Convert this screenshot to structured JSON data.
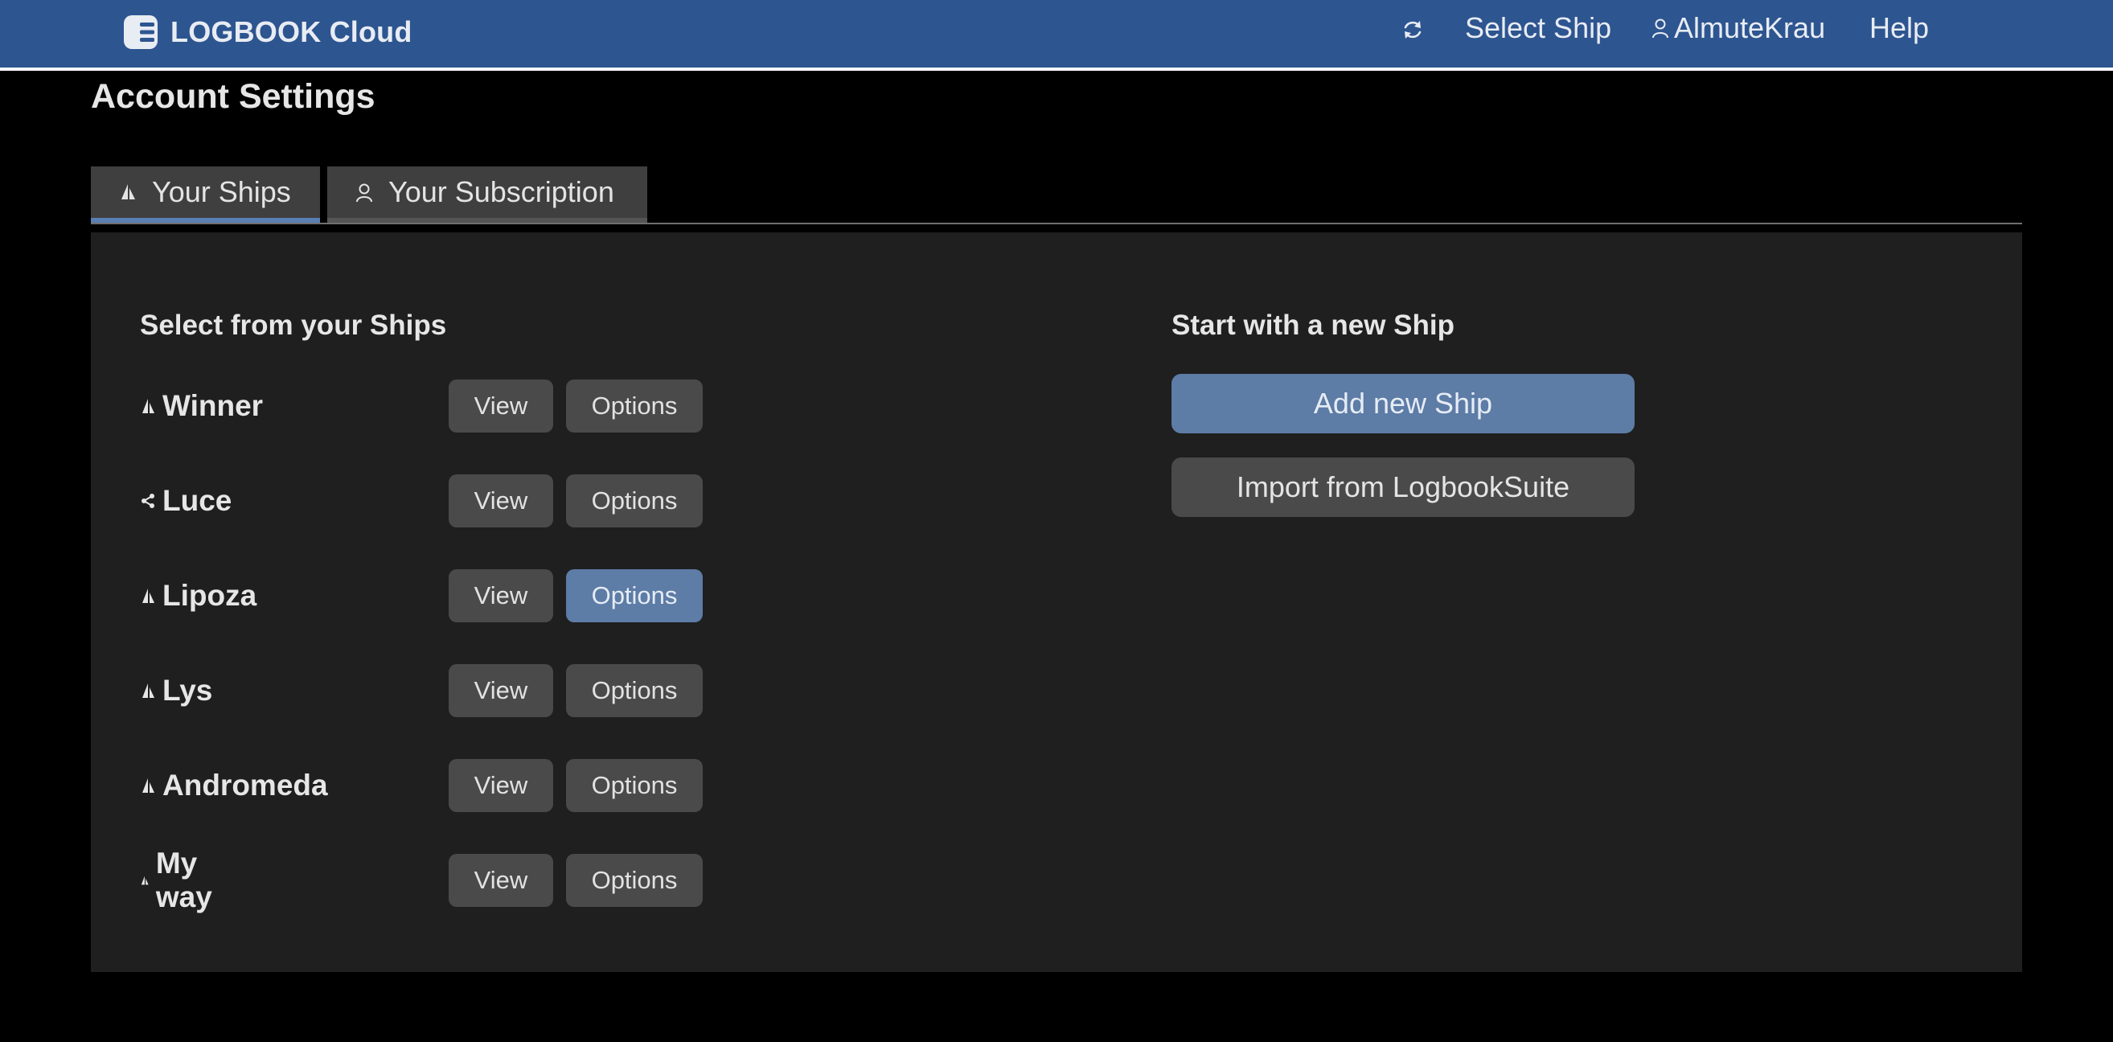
{
  "brand": {
    "name": "LOGBOOK Cloud"
  },
  "nav": {
    "select_ship": "Select Ship",
    "user": "AlmuteKrau",
    "help": "Help"
  },
  "page": {
    "title": "Account Settings"
  },
  "tabs": [
    {
      "label": "Your Ships",
      "active": true,
      "icon": "sailboat-icon"
    },
    {
      "label": "Your Subscription",
      "active": false,
      "icon": "user-icon"
    }
  ],
  "ships_section": {
    "title": "Select from your Ships",
    "view_label": "View",
    "options_label": "Options",
    "ships": [
      {
        "name": "Winner",
        "icon": "sailboat-icon"
      },
      {
        "name": "Luce",
        "icon": "share-icon"
      },
      {
        "name": "Lipoza",
        "icon": "sailboat-icon",
        "options_highlighted": true
      },
      {
        "name": "Lys",
        "icon": "sailboat-icon"
      },
      {
        "name": "Andromeda",
        "icon": "sailboat-icon"
      },
      {
        "name": "My way",
        "icon": "sailboat-icon"
      }
    ]
  },
  "new_ship_section": {
    "title": "Start with a new Ship",
    "add_button": "Add new Ship",
    "import_button": "Import from LogbookSuite"
  },
  "colors": {
    "navbar": "#2d5590",
    "accent": "#5d7ca6",
    "panel": "#1f1f1f",
    "button": "#4a4a4a"
  }
}
